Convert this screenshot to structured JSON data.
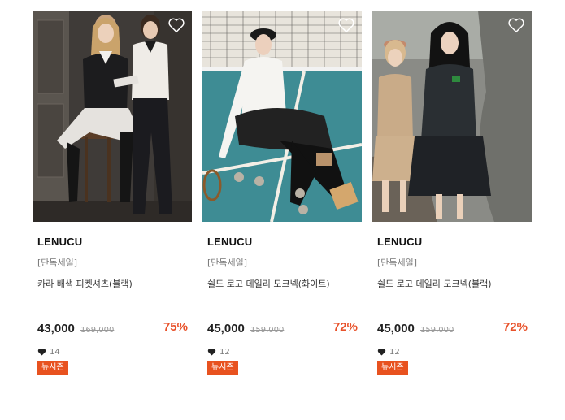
{
  "products": [
    {
      "brand": "LENUCU",
      "tag": "[단독세일]",
      "name": "카라 배색 피켓셔츠(블랙)",
      "price": "43,000",
      "original_price": "169,000",
      "discount": "75%",
      "likes": "14",
      "badge": "뉴시즌"
    },
    {
      "brand": "LENUCU",
      "tag": "[단독세일]",
      "name": "쉴드 로고 데일리 모크넥(화이트)",
      "price": "45,000",
      "original_price": "159,000",
      "discount": "72%",
      "likes": "12",
      "badge": "뉴시즌"
    },
    {
      "brand": "LENUCU",
      "tag": "[단독세일]",
      "name": "쉴드 로고 데일리 모크넥(블랙)",
      "price": "45,000",
      "original_price": "159,000",
      "discount": "72%",
      "likes": "12",
      "badge": "뉴시즌"
    }
  ],
  "colors": {
    "discount": "#e8522b",
    "badge_bg": "#e8521f"
  },
  "icons": {
    "wishlist": "heart-outline-icon",
    "likes": "heart-filled-icon"
  }
}
